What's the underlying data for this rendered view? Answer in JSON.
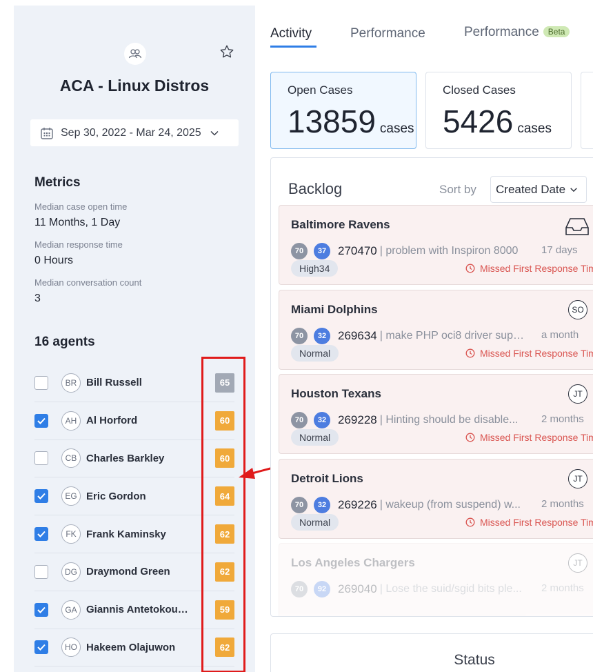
{
  "project": {
    "title": "ACA - Linux Distros",
    "date_range": "Sep 30, 2022 - Mar 24, 2025"
  },
  "metrics": {
    "heading": "Metrics",
    "items": [
      {
        "label": "Median case open time",
        "value": "11 Months, 1 Day"
      },
      {
        "label": "Median response time",
        "value": "0 Hours"
      },
      {
        "label": "Median conversation count",
        "value": "3"
      }
    ]
  },
  "agents": {
    "heading": "16 agents",
    "list": [
      {
        "initials": "BR",
        "name": "Bill Russell",
        "score": "65",
        "checked": false,
        "score_color": "#a2a9b5"
      },
      {
        "initials": "AH",
        "name": "Al Horford",
        "score": "60",
        "checked": true,
        "score_color": "#f0a93a"
      },
      {
        "initials": "CB",
        "name": "Charles Barkley",
        "score": "60",
        "checked": false,
        "score_color": "#f0a93a"
      },
      {
        "initials": "EG",
        "name": "Eric Gordon",
        "score": "64",
        "checked": true,
        "score_color": "#f0a93a"
      },
      {
        "initials": "FK",
        "name": "Frank Kaminsky",
        "score": "62",
        "checked": true,
        "score_color": "#f0a93a"
      },
      {
        "initials": "DG",
        "name": "Draymond Green",
        "score": "62",
        "checked": false,
        "score_color": "#f0a93a"
      },
      {
        "initials": "GA",
        "name": "Giannis Antetokoun...",
        "score": "59",
        "checked": true,
        "score_color": "#f0a93a"
      },
      {
        "initials": "HO",
        "name": "Hakeem Olajuwon",
        "score": "62",
        "checked": true,
        "score_color": "#f0a93a"
      }
    ]
  },
  "tabs": {
    "activity": "Activity",
    "performance": "Performance",
    "performance_beta": "Performance",
    "beta_badge": "Beta"
  },
  "stats": {
    "open": {
      "label": "Open Cases",
      "value": "13859",
      "unit": "cases"
    },
    "closed": {
      "label": "Closed Cases",
      "value": "5426",
      "unit": "cases"
    }
  },
  "backlog": {
    "title": "Backlog",
    "sort_label": "Sort by",
    "sort_value": "Created Date",
    "cases": [
      {
        "name": "Baltimore Ravens",
        "score_a": "70",
        "score_b": "37",
        "id": "270470",
        "desc": "| problem with Inspiron 8000",
        "time": "17 days",
        "priority": "High34",
        "missed": "Missed First Response Time",
        "assignee": ""
      },
      {
        "name": "Miami Dolphins",
        "score_a": "70",
        "score_b": "32",
        "id": "269634",
        "desc": "| make PHP oci8 driver supp...",
        "time": "a month",
        "priority": "Normal",
        "missed": "Missed First Response Time",
        "assignee": "SO"
      },
      {
        "name": "Houston Texans",
        "score_a": "70",
        "score_b": "32",
        "id": "269228",
        "desc": "| Hinting should be disable...",
        "time": "2 months",
        "priority": "Normal",
        "missed": "Missed First Response Time",
        "assignee": "JT"
      },
      {
        "name": "Detroit Lions",
        "score_a": "70",
        "score_b": "32",
        "id": "269226",
        "desc": "| wakeup (from suspend) w...",
        "time": "2 months",
        "priority": "Normal",
        "missed": "Missed First Response Time",
        "assignee": "JT"
      },
      {
        "name": "Los Angeles Chargers",
        "score_a": "70",
        "score_b": "92",
        "id": "269040",
        "desc": "| Lose the suid/sgid bits ple...",
        "time": "2 months",
        "priority": "",
        "missed": "",
        "assignee": "JT"
      }
    ]
  },
  "status": {
    "title": "Status"
  },
  "colors": {
    "accent": "#2f7ee6",
    "highlight": "#e01b1b",
    "score_orange": "#f0a93a",
    "score_gray": "#a2a9b5"
  }
}
